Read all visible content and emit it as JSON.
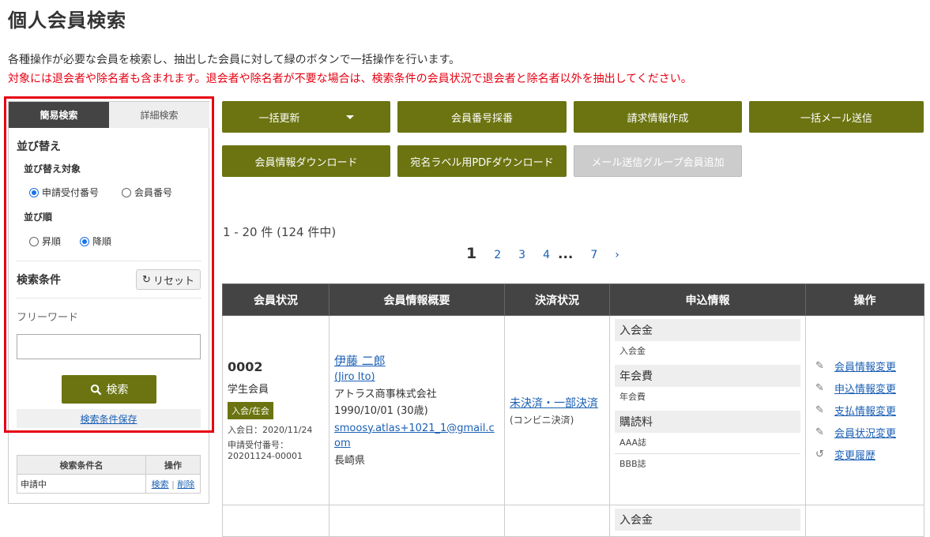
{
  "page": {
    "title": "個人会員検索",
    "desc1": "各種操作が必要な会員を検索し、抽出した会員に対して緑のボタンで一括操作を行います。",
    "desc2": "対象には退会者や除名者も含まれます。退会者や除名者が不要な場合は、検索条件の会員状況で退会者と除名者以外を抽出してください。"
  },
  "colors": {
    "accent": "#6b7410",
    "highlight": "#e60012",
    "link": "#1a5fb4",
    "header_bg": "#444444"
  },
  "search_panel": {
    "tabs": [
      "簡易検索",
      "詳細検索"
    ],
    "sort_title": "並び替え",
    "sort_target_label": "並び替え対象",
    "sort_target_options": [
      "申請受付番号",
      "会員番号"
    ],
    "sort_target_selected": "申請受付番号",
    "sort_order_label": "並び順",
    "sort_order_options": [
      "昇順",
      "降順"
    ],
    "sort_order_selected": "降順",
    "conditions_title": "検索条件",
    "reset_label": "リセット",
    "freeword_label": "フリーワード",
    "freeword_value": "",
    "search_label": "検索",
    "save_conditions_label": "検索条件保存",
    "saved_table": {
      "headers": [
        "検索条件名",
        "操作"
      ],
      "rows": [
        {
          "name": "申請中",
          "search": "検索",
          "sep": "|",
          "delete": "削除"
        }
      ]
    }
  },
  "actions": {
    "row1": [
      "一括更新",
      "会員番号採番",
      "請求情報作成",
      "一括メール送信"
    ],
    "row2": [
      "会員情報ダウンロード",
      "宛名ラベル用PDFダウンロード",
      "メール送信グループ会員追加"
    ]
  },
  "results": {
    "count_text": "1 - 20 件 (124 件中)",
    "pager": {
      "current": "1",
      "pages": [
        "2",
        "3",
        "4"
      ],
      "ellipsis": "...",
      "last": "7",
      "next": "›"
    },
    "headers": [
      "会員状況",
      "会員情報概要",
      "決済状況",
      "申込情報",
      "操作"
    ],
    "row": {
      "member_no": "0002",
      "member_type": "学生会員",
      "status_badge": "入会/在会",
      "join_date": "入会日：2020/11/24",
      "app_no_label": "申請受付番号：",
      "app_no": "20201124-00001",
      "name": "伊藤 二郎",
      "name_roman": "(Jiro Ito)",
      "company": "アトラス商事株式会社",
      "birth": "1990/10/01 (30歳)",
      "email": "smoosy.atlas+1021_1@gmail.com",
      "pref": "長崎県",
      "payment_status": "未決済・一部決済",
      "payment_method": "(コンビニ決済)",
      "apply": [
        {
          "head": "入会金",
          "items": [
            "入会金"
          ]
        },
        {
          "head": "年会費",
          "items": [
            "年会費"
          ]
        },
        {
          "head": "購読料",
          "items": [
            "AAA誌",
            "BBB誌"
          ]
        }
      ],
      "operations": [
        "会員情報変更",
        "申込情報変更",
        "支払情報変更",
        "会員状況変更",
        "変更履歴"
      ],
      "next_row_peek": "入会金"
    }
  }
}
